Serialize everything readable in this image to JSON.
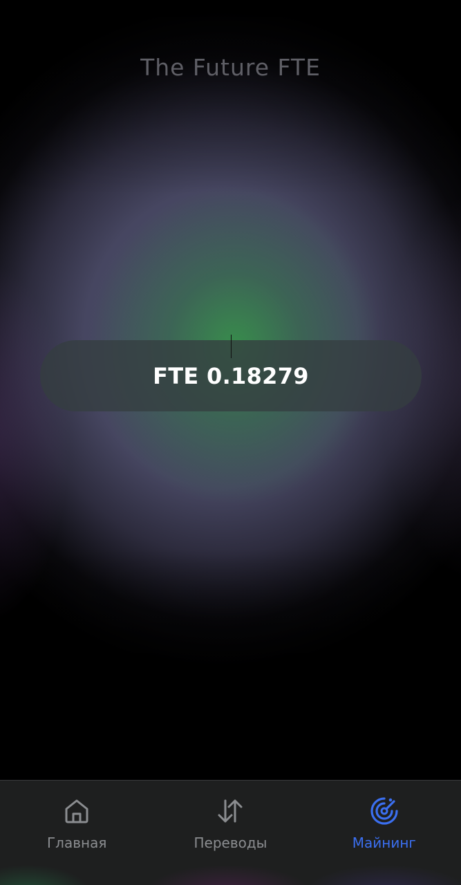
{
  "app": {
    "title": "The Future FTE"
  },
  "balance": {
    "text": "FTE 0.18279",
    "currency": "FTE",
    "value": 0.18279
  },
  "nav": {
    "items": [
      {
        "label": "Главная",
        "icon": "home-icon",
        "active": false
      },
      {
        "label": "Переводы",
        "icon": "transfer-arrows-icon",
        "active": false
      },
      {
        "label": "Майнинг",
        "icon": "radar-icon",
        "active": true
      }
    ]
  },
  "colors": {
    "active": "#3b6ff0",
    "inactive": "#8b8d90",
    "accent_glow": "#349646"
  }
}
